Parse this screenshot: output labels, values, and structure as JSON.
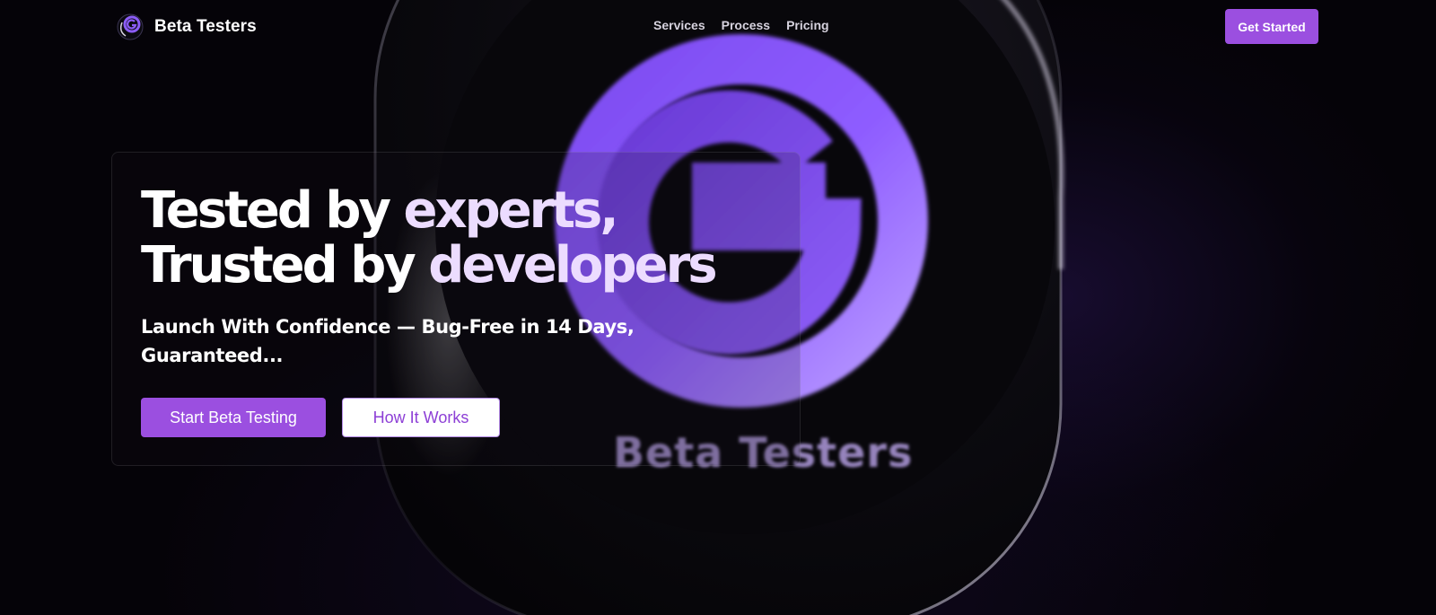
{
  "brand": {
    "name": "Beta Testers",
    "logo_icon": "g-logo-icon",
    "accent_color": "#9b4fe0"
  },
  "nav": {
    "links": [
      "Services",
      "Process",
      "Pricing"
    ],
    "cta_label": "Get Started"
  },
  "hero": {
    "title_line1_strong": "Tested by",
    "title_line1_light": "experts,",
    "title_line2_strong": "Trusted by",
    "title_line2_light": "developers",
    "subtitle": "Launch With Confidence — Bug-Free in 14 Days, Guaranteed...",
    "primary_button": "Start Beta Testing",
    "secondary_button": "How It Works"
  },
  "background_art": {
    "badge_text": "Beta Testers",
    "badge_icon": "g-logo-badge-icon"
  }
}
